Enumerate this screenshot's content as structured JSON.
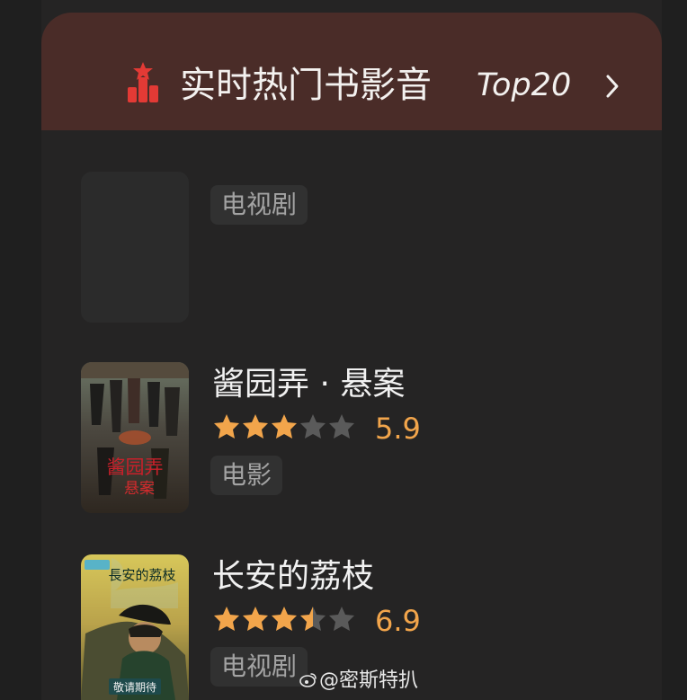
{
  "header": {
    "icon": "trophy-chart-icon",
    "title": "实时热门书影音",
    "top_label": "Top20",
    "chevron": "chevron-right-icon",
    "accent_color": "#e33a35"
  },
  "items": [
    {
      "title": "",
      "tag": "电视剧",
      "rating": null,
      "score": ""
    },
    {
      "title": "酱园弄 · 悬案",
      "rating": 5.9,
      "score": "5.9",
      "tag": "电影",
      "star_fill": 3,
      "poster_text_1": "酱园弄",
      "poster_text_2": "悬案"
    },
    {
      "title": "长安的荔枝",
      "rating": 6.9,
      "score": "6.9",
      "tag": "电视剧",
      "star_fill": 3.5,
      "poster_text_1": "長安的荔枝",
      "poster_text_2": "敬请期待"
    }
  ],
  "watermark": {
    "text": "@密斯特扒",
    "icon": "weibo-logo-icon"
  },
  "colors": {
    "background": "#1f1f1f",
    "header": "#4a2c28",
    "star_active": "#f2a54b",
    "star_inactive": "#5a5a5a",
    "tag_background": "#313131",
    "tag_text": "#a3a3a3"
  }
}
